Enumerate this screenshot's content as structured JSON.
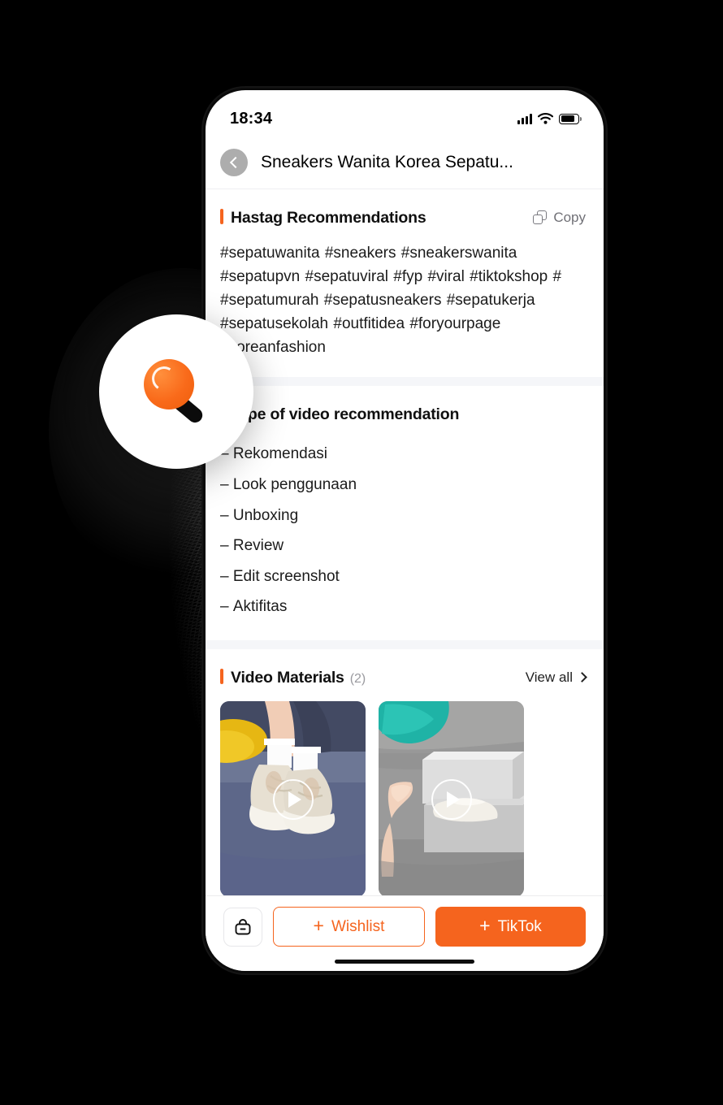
{
  "status_bar": {
    "time": "18:34",
    "icons": [
      "cellular-signal-icon",
      "wifi-icon",
      "battery-icon"
    ]
  },
  "nav": {
    "back_icon": "chevron-left-icon",
    "title": "Sneakers Wanita Korea Sepatu..."
  },
  "hashtag_section": {
    "title": "Hastag Recommendations",
    "copy_label": "Copy",
    "copy_icon": "copy-icon",
    "tags": "#sepatuwanita #sneakers #sneakerswanita #sepatupvn #sepatuviral #fyp #viral #tiktokshop # #sepatumurah #sepatusneakers #sepatukerja #sepatusekolah #outfitidea #foryourpage #koreanfashion"
  },
  "video_type_section": {
    "title": "Type of video recommendation",
    "items": [
      "Rekomendasi",
      "Look penggunaan",
      "Unboxing",
      "Review",
      "Edit screenshot",
      "Aktifitas"
    ]
  },
  "materials_section": {
    "title": "Video Materials",
    "count": "(2)",
    "view_all_label": "View all",
    "view_all_icon": "chevron-right-icon",
    "thumbnails": [
      {
        "name": "sneakers-on-rug-thumbnail",
        "play_icon": "play-icon"
      },
      {
        "name": "shoe-box-unboxing-thumbnail",
        "play_icon": "play-icon"
      }
    ]
  },
  "action_bar": {
    "shop_icon": "shopping-bag-icon",
    "wishlist_label": "Wishlist",
    "tiktok_label": "TikTok",
    "plus_sign": "+"
  },
  "badge": {
    "icon": "lightbulb-magnifier-icon"
  },
  "colors": {
    "accent": "#f5641e",
    "divider": "#f5f6f9",
    "text": "#1b1b1b",
    "muted": "#9a9a9f",
    "back_button": "#adadad"
  }
}
